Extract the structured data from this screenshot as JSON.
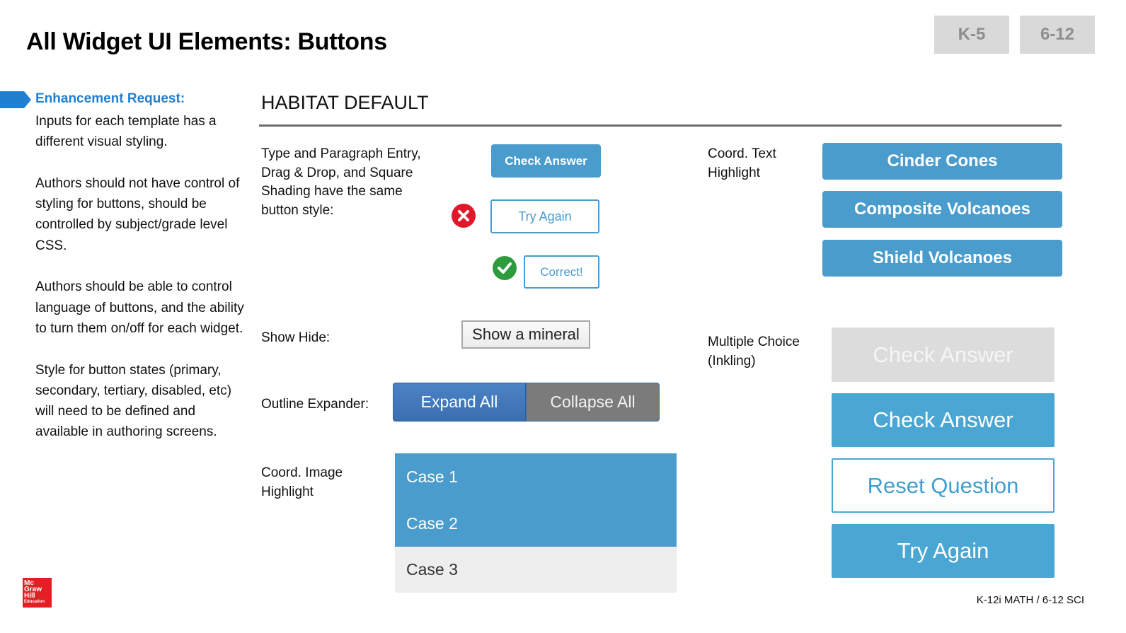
{
  "title": "All Widget UI Elements: Buttons",
  "grade_tabs": [
    {
      "label": "K-5"
    },
    {
      "label": "6-12"
    }
  ],
  "enhancement": {
    "title": "Enhancement Request:",
    "paragraphs": [
      "Inputs for each template has a different visual styling.",
      "Authors should not have control of styling for buttons, should be controlled by subject/grade level CSS.",
      "Authors should be able to control language of buttons, and the ability to turn them on/off for each widget.",
      "Style for button states (primary, secondary, tertiary, disabled, etc) will need to be defined and available in authoring screens."
    ]
  },
  "section_title": "HABITAT DEFAULT",
  "type_paragraph": {
    "label": "Type and Paragraph Entry, Drag & Drop, and Square Shading have the same button style:",
    "check_answer": "Check Answer",
    "try_again": "Try Again",
    "correct": "Correct!",
    "incorrect_icon": "x-circle-icon",
    "correct_icon": "check-circle-icon"
  },
  "show_hide": {
    "label": "Show Hide:",
    "button": "Show a mineral"
  },
  "outline_expander": {
    "label": "Outline Expander:",
    "expand": "Expand All",
    "collapse": "Collapse All"
  },
  "coord_image": {
    "label": "Coord. Image Highlight",
    "cases": [
      {
        "label": "Case 1",
        "selected": true
      },
      {
        "label": "Case 2",
        "selected": true
      },
      {
        "label": "Case 3",
        "selected": false
      }
    ]
  },
  "coord_text": {
    "label": "Coord. Text Highlight",
    "buttons": [
      "Cinder Cones",
      "Composite Volcanoes",
      "Shield Volcanoes"
    ]
  },
  "multiple_choice": {
    "label": "Multiple Choice (Inkling)",
    "check_disabled": "Check Answer",
    "check_active": "Check Answer",
    "reset": "Reset Question",
    "try_again": "Try Again"
  },
  "colors": {
    "accent_blue": "#4a9ccc",
    "enhancement_blue": "#1f7fd0",
    "error_red": "#e0192a",
    "success_green": "#2e9b3e",
    "brand_red": "#e31e24"
  },
  "logo": {
    "lines": [
      "Mc",
      "Graw",
      "Hill",
      "Education"
    ]
  },
  "footer": "K-12i MATH / 6-12 SCI"
}
